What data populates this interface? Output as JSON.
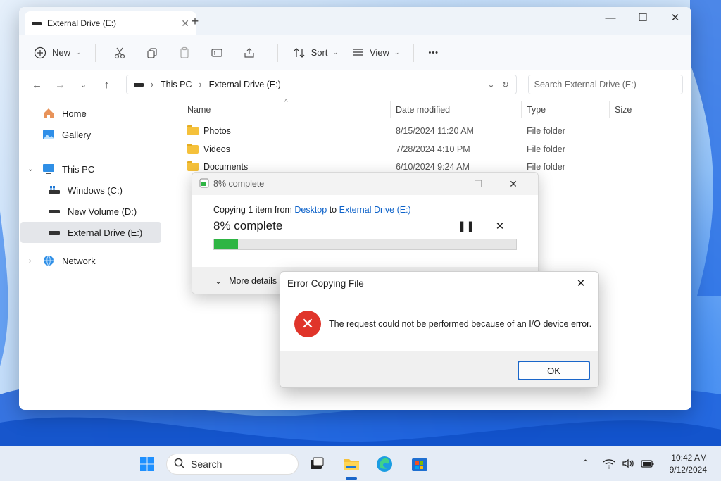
{
  "explorer": {
    "tab_title": "External Drive (E:)",
    "toolbar": {
      "new": "New",
      "sort": "Sort",
      "view": "View",
      "more": "•••"
    },
    "breadcrumb": [
      "This PC",
      "External Drive (E:)"
    ],
    "search_placeholder": "Search External Drive (E:)",
    "sidebar": {
      "home": "Home",
      "gallery": "Gallery",
      "this_pc": "This PC",
      "drive_c": "Windows (C:)",
      "drive_d": "New Volume (D:)",
      "drive_e": "External Drive (E:)",
      "network": "Network"
    },
    "columns": {
      "name": "Name",
      "date": "Date modified",
      "type": "Type",
      "size": "Size"
    },
    "files": [
      {
        "name": "Photos",
        "date": "8/15/2024 11:20 AM",
        "type": "File folder"
      },
      {
        "name": "Videos",
        "date": "7/28/2024 4:10 PM",
        "type": "File folder"
      },
      {
        "name": "Documents",
        "date": "6/10/2024 9:24 AM",
        "type": "File folder"
      }
    ]
  },
  "progress_dialog": {
    "title": "8% complete",
    "line_prefix": "Copying 1 item from",
    "source": "Desktop",
    "line_mid": "to",
    "destination": "External Drive (E:)",
    "percent_label": "8% complete",
    "progress": 0.08,
    "more_details": "More details"
  },
  "error_dialog": {
    "title": "Error Copying File",
    "message": "The request could not be performed because of an I/O device error.",
    "ok": "OK"
  },
  "taskbar": {
    "search": "Search",
    "time": "10:42 AM",
    "date": "9/12/2024"
  },
  "colors": {
    "accent": "#1a66c9",
    "progress_fill": "#2fb544",
    "error": "#e0342a",
    "folder": "#f5c13b"
  }
}
